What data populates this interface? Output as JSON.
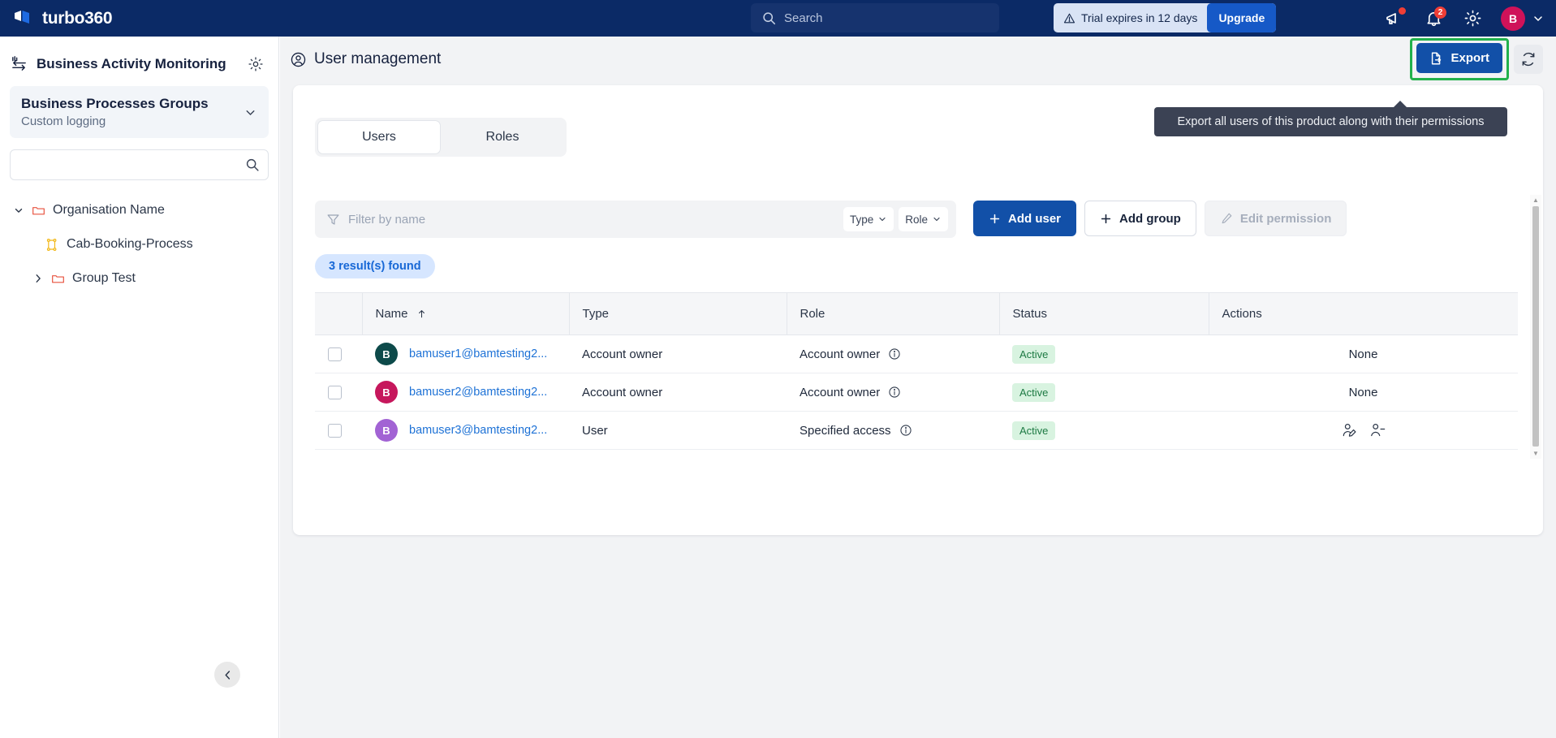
{
  "topbar": {
    "brand": "turbo360",
    "search_placeholder": "Search",
    "trial_text": "Trial expires in 12 days",
    "upgrade_label": "Upgrade",
    "announce_icon": "megaphone-icon",
    "notification_count": "2",
    "settings_icon": "gear-icon",
    "avatar_initial": "B",
    "accent_blue": "#1659c7",
    "bar_bg": "#0b2a66"
  },
  "sidebar": {
    "product_title": "Business Activity Monitoring",
    "settings_icon": "gear-icon",
    "selector": {
      "title": "Business Processes Groups",
      "subtitle": "Custom logging"
    },
    "search_value": "",
    "search_placeholder": "",
    "tree": [
      {
        "label": "Organisation Name",
        "icon": "folder-icon",
        "level": 1,
        "expanded": true
      },
      {
        "label": "Cab-Booking-Process",
        "icon": "process-icon",
        "level": 2,
        "expanded": false
      },
      {
        "label": "Group Test",
        "icon": "folder-icon",
        "level": 2,
        "expanded": false
      }
    ],
    "collapse_icon": "chevron-left-icon"
  },
  "page": {
    "title": "User management",
    "title_icon": "user-circle-icon",
    "export_label": "Export",
    "export_icon": "export-file-icon",
    "refresh_icon": "refresh-icon",
    "tooltip": "Export all users of this product along with their permissions",
    "highlight_color": "#22b14c"
  },
  "tabs": [
    {
      "label": "Users",
      "active": true
    },
    {
      "label": "Roles",
      "active": false
    }
  ],
  "filters": {
    "name_placeholder": "Filter by name",
    "name_value": "",
    "filter_icon": "funnel-icon",
    "type_label": "Type",
    "role_label": "Role"
  },
  "toolbar": {
    "add_user_label": "Add user",
    "add_group_label": "Add group",
    "edit_permission_label": "Edit permission",
    "edit_permission_icon": "pencil-icon"
  },
  "results_chip": "3 result(s) found",
  "table": {
    "columns": [
      "Name",
      "Type",
      "Role",
      "Status",
      "Actions"
    ],
    "sort_column": "Name",
    "sort_direction": "asc",
    "rows": [
      {
        "checked": false,
        "avatar_initial": "B",
        "avatar_color": "#0d4a4a",
        "email": "bamuser1@bamtesting2...",
        "type": "Account owner",
        "role": "Account owner",
        "role_info_icon": "info-icon",
        "status": "Active",
        "actions": "None"
      },
      {
        "checked": false,
        "avatar_initial": "B",
        "avatar_color": "#c6175c",
        "email": "bamuser2@bamtesting2...",
        "type": "Account owner",
        "role": "Account owner",
        "role_info_icon": "info-icon",
        "status": "Active",
        "actions": "None"
      },
      {
        "checked": false,
        "avatar_initial": "B",
        "avatar_color": "#a263d4",
        "email": "bamuser3@bamtesting2...",
        "type": "User",
        "role": "Specified access",
        "role_info_icon": "info-icon",
        "status": "Active",
        "actions": "icons",
        "action_icons": [
          "edit-user-icon",
          "remove-user-icon"
        ]
      }
    ]
  }
}
